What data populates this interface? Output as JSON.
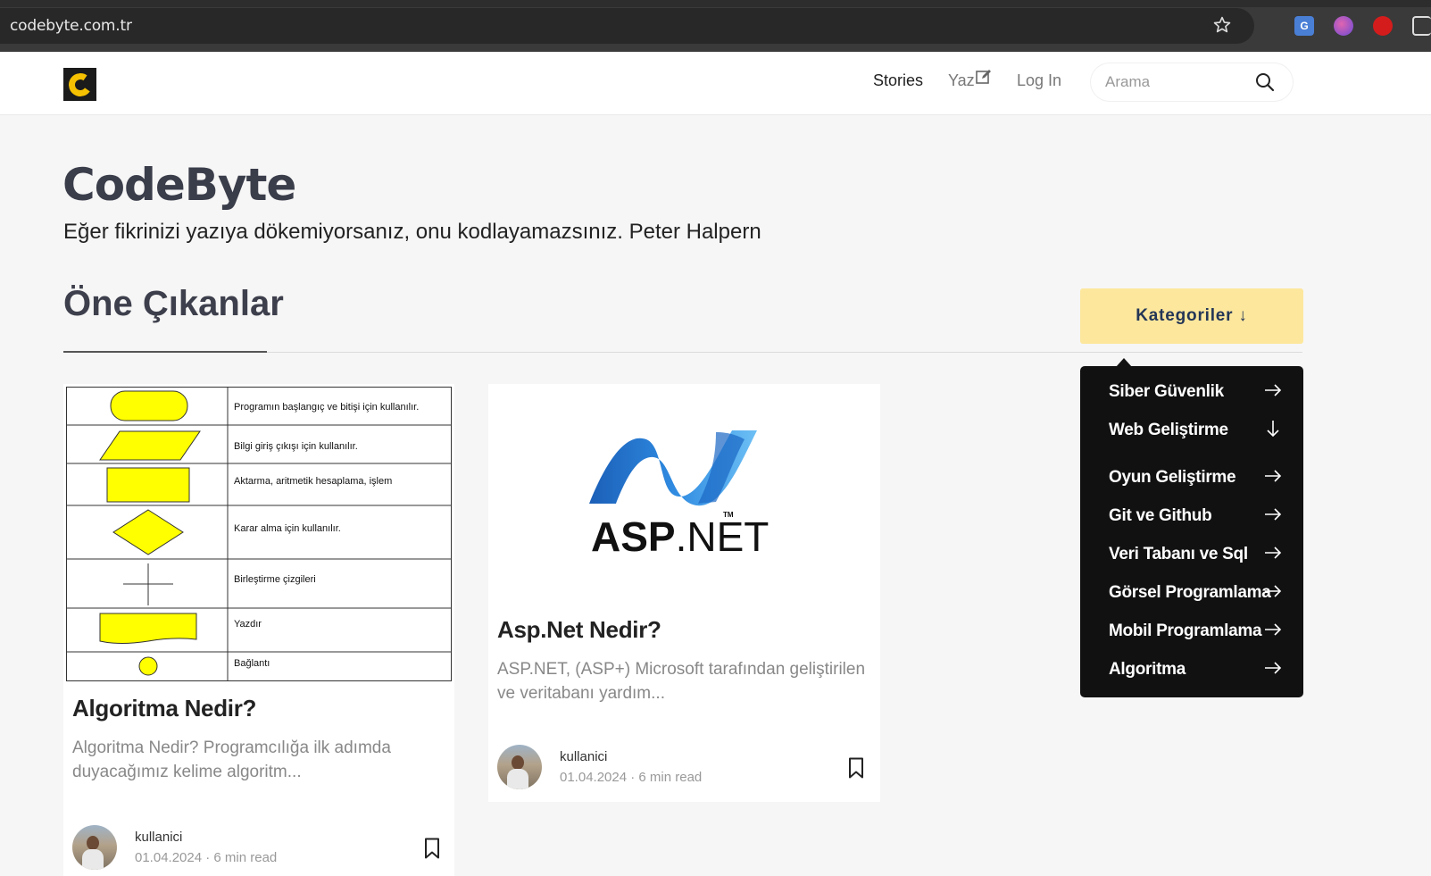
{
  "browser": {
    "url": "codebyte.com.tr"
  },
  "header": {
    "nav": {
      "stories": "Stories",
      "yaz": "Yaz",
      "login": "Log In"
    },
    "search": {
      "placeholder": "Arama"
    }
  },
  "hero": {
    "title": "CodeByte",
    "quote": "Eğer fikrinizi yazıya dökemiyorsanız, onu kodlayamazsınız. Peter Halpern"
  },
  "section": {
    "title": "Öne Çıkanlar",
    "categories_button": "Kategoriler ↓"
  },
  "categories": [
    {
      "label": "Siber Güvenlik",
      "arrow": "right"
    },
    {
      "label": "Web Geliştirme",
      "arrow": "down"
    },
    {
      "label": "Oyun Geliştirme",
      "arrow": "right"
    },
    {
      "label": "Git ve Github",
      "arrow": "right"
    },
    {
      "label": "Veri Tabanı ve Sql",
      "arrow": "right"
    },
    {
      "label": "Görsel Programlama",
      "arrow": "right"
    },
    {
      "label": "Mobil Programlama",
      "arrow": "right"
    },
    {
      "label": "Algoritma",
      "arrow": "right"
    }
  ],
  "flowchart_rows": [
    "Programın başlangıç ve bitişi için kullanılır.",
    "Bilgi giriş çıkışı için kullanılır.",
    "Aktarma, aritmetik hesaplama, işlem",
    "Karar alma için kullanılır.",
    "Birleştirme çizgileri",
    "Yazdır",
    "Bağlantı"
  ],
  "cards": [
    {
      "title": "Algoritma Nedir?",
      "excerpt_line1": "Algoritma Nedir? Programcılığa ilk adımda",
      "excerpt_line2": "duyacağımız kelime algoritm...",
      "author": "kullanici",
      "meta": "01.04.2024 · 6 min read"
    },
    {
      "title": "Asp.Net Nedir?",
      "excerpt_line1": "ASP.NET, (ASP+) Microsoft tarafından geliştirilen",
      "excerpt_line2": "ve veritabanı yardım...",
      "author": "kullanici",
      "meta": "01.04.2024 · 6 min read",
      "logo_text_bold": "ASP",
      "logo_text_light": ".NET",
      "logo_tm": "TM"
    }
  ],
  "colors": {
    "accent_button": "#fde79d",
    "dropdown_bg": "#111111",
    "logo_yellow": "#f5c100",
    "asp_blue": "#1e6fd0"
  },
  "icons": [
    "star-icon",
    "translate-icon",
    "brain-icon",
    "hand-icon",
    "puzzle-icon",
    "edit-icon",
    "search-icon",
    "arrow-right-icon",
    "arrow-down-icon",
    "bookmark-icon"
  ]
}
